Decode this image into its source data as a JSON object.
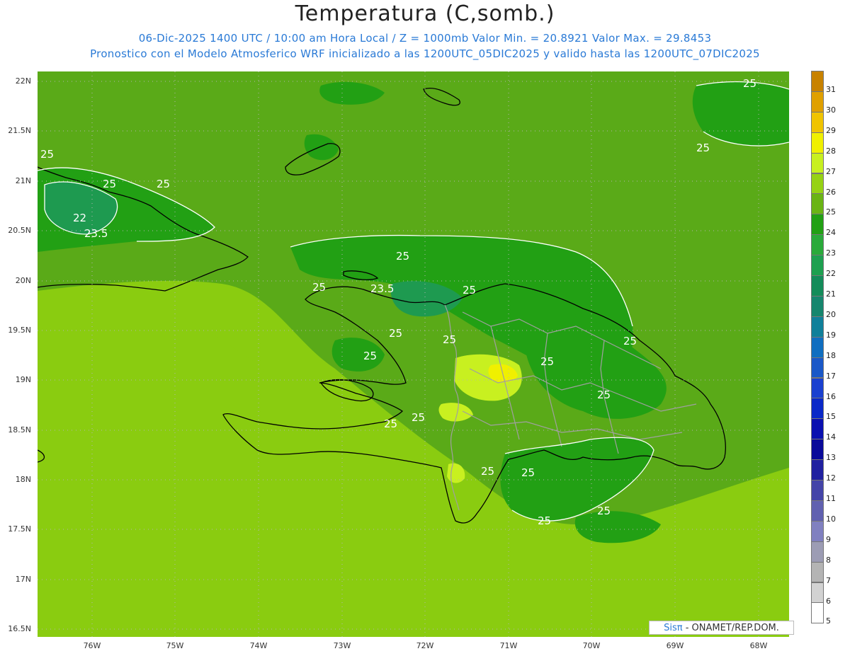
{
  "header": {
    "title": "Temperatura (C,somb.)",
    "subtitle1": "06-Dic-2025 1400 UTC / 10:00 am Hora Local / Z = 1000mb  Valor Min. = 20.8921  Valor Max. = 29.8453",
    "subtitle2": "Pronostico con el Modelo Atmosferico WRF inicializado a las 1200UTC_05DIC2025 y valido hasta las  1200UTC_07DIC2025"
  },
  "map": {
    "lat_labels": [
      "22N",
      "21.5N",
      "21N",
      "20.5N",
      "20N",
      "19.5N",
      "19N",
      "18.5N",
      "18N",
      "17.5N",
      "17N",
      "16.5N"
    ],
    "lon_labels": [
      "76W",
      "75W",
      "74W",
      "73W",
      "72W",
      "71W",
      "70W",
      "69W",
      "68W"
    ],
    "contour_labels": [
      "25",
      "25",
      "25",
      "22",
      "23.5",
      "25",
      "25",
      "23.5",
      "25",
      "25",
      "25",
      "25",
      "25",
      "25",
      "25",
      "25",
      "25",
      "25",
      "25",
      "25",
      "25",
      "25",
      "25"
    ],
    "colors": {
      "c21": "#0f8c4a",
      "c22": "#1f9d46",
      "c23": "#2aa83c",
      "c24": "#3aa52a",
      "c25": "#5aaa18",
      "c26": "#8acc10",
      "c27": "#a8dc20",
      "c28": "#d8f020",
      "coast": "#000000",
      "border": "#a0a0a0"
    }
  },
  "colorbar": {
    "labels": [
      "31",
      "30",
      "29",
      "28",
      "27",
      "26",
      "25",
      "24",
      "23",
      "22",
      "21",
      "20",
      "19",
      "18",
      "17",
      "16",
      "15",
      "14",
      "13",
      "12",
      "11",
      "10",
      "9",
      "8",
      "7",
      "6",
      "5"
    ],
    "colors": [
      "#c88200",
      "#e0a000",
      "#f0c400",
      "#f0f000",
      "#c8f020",
      "#96d214",
      "#6ab414",
      "#22a014",
      "#2aaa3a",
      "#1ea050",
      "#148c5a",
      "#16866e",
      "#10809a",
      "#106ec0",
      "#1a58c8",
      "#1a40d0",
      "#0a28c8",
      "#0a10b0",
      "#0a0a9a",
      "#2020a0",
      "#4444a8",
      "#6060b0",
      "#8080c0",
      "#9c9cb4",
      "#b4b4b4",
      "#d2d2d2",
      "#ffffff"
    ]
  },
  "credit": {
    "brand": "Sisπ",
    "text": "- ONAMET/REP.DOM."
  }
}
